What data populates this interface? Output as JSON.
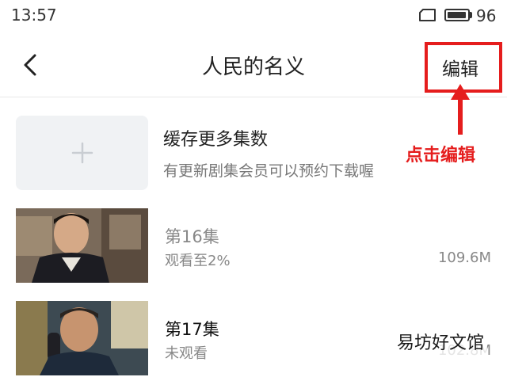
{
  "status_bar": {
    "time": "13:57",
    "battery_level": "96",
    "battery_percent": 96
  },
  "nav": {
    "title": "人民的名义",
    "edit_label": "编辑"
  },
  "annotation": {
    "text": "点击编辑",
    "color": "#e51d1d"
  },
  "cache_more": {
    "title": "缓存更多集数",
    "subtitle": "有更新剧集会员可以预约下载喔"
  },
  "episodes": [
    {
      "title": "第16集",
      "status": "观看至2%",
      "size": "109.6M"
    },
    {
      "title": "第17集",
      "status": "未观看",
      "size": "102.8M"
    }
  ],
  "watermark": "易坊好文馆"
}
